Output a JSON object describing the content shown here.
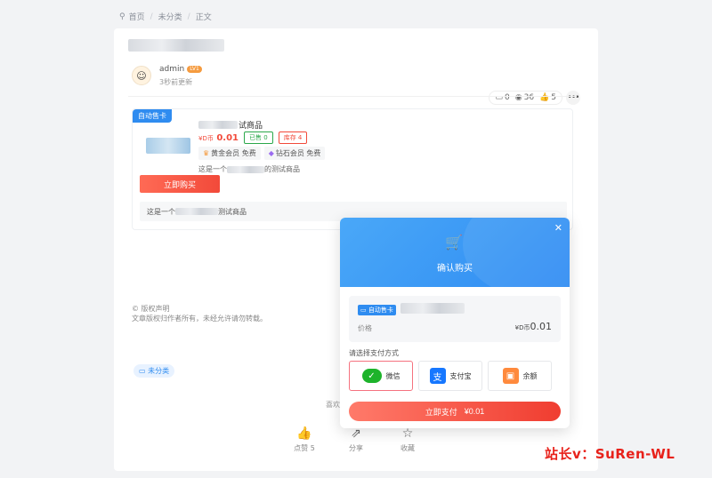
{
  "breadcrumb": {
    "home": "首页",
    "category": "未分类",
    "current": "正文"
  },
  "author": {
    "name": "admin",
    "level": "LV1",
    "updated": "3秒前更新"
  },
  "stats": {
    "comments": "0",
    "views": "36",
    "likes": "5"
  },
  "product": {
    "badge": "自动售卡",
    "name_suffix": "试商品",
    "price_unit": "¥D币",
    "price": "0.01",
    "sold": "已售 0",
    "stock": "库存 4",
    "gold_member": "黄金会员 免费",
    "diamond_member": "钻石会员 免费",
    "desc_prefix": "这是一个",
    "desc_suffix": "的测试商品",
    "buy_label": "立即购买",
    "detail_prefix": "这是一个",
    "detail_suffix": "测试商品"
  },
  "copyright": {
    "title": "© 版权声明",
    "text": "文章版权归作者所有，未经允许请勿转载。"
  },
  "category_tag": "未分类",
  "reward_text": "喜欢",
  "actions": {
    "like": "点赞 5",
    "share": "分享",
    "favorite": "收藏"
  },
  "modal": {
    "title": "确认购买",
    "badge": "自动售卡",
    "price_label": "价格",
    "price_unit": "¥D币",
    "price": "0.01",
    "pay_method_label": "请选择支付方式",
    "methods": {
      "wechat": "微信",
      "alipay": "支付宝",
      "balance": "余额"
    },
    "pay_button": "立即支付",
    "pay_amount": "¥0.01"
  },
  "watermark": "站长v：SuRen-WL",
  "colors": {
    "accent_blue": "#2f8cf0",
    "price_red": "#f24a3a",
    "wechat_green": "#1db32b"
  }
}
